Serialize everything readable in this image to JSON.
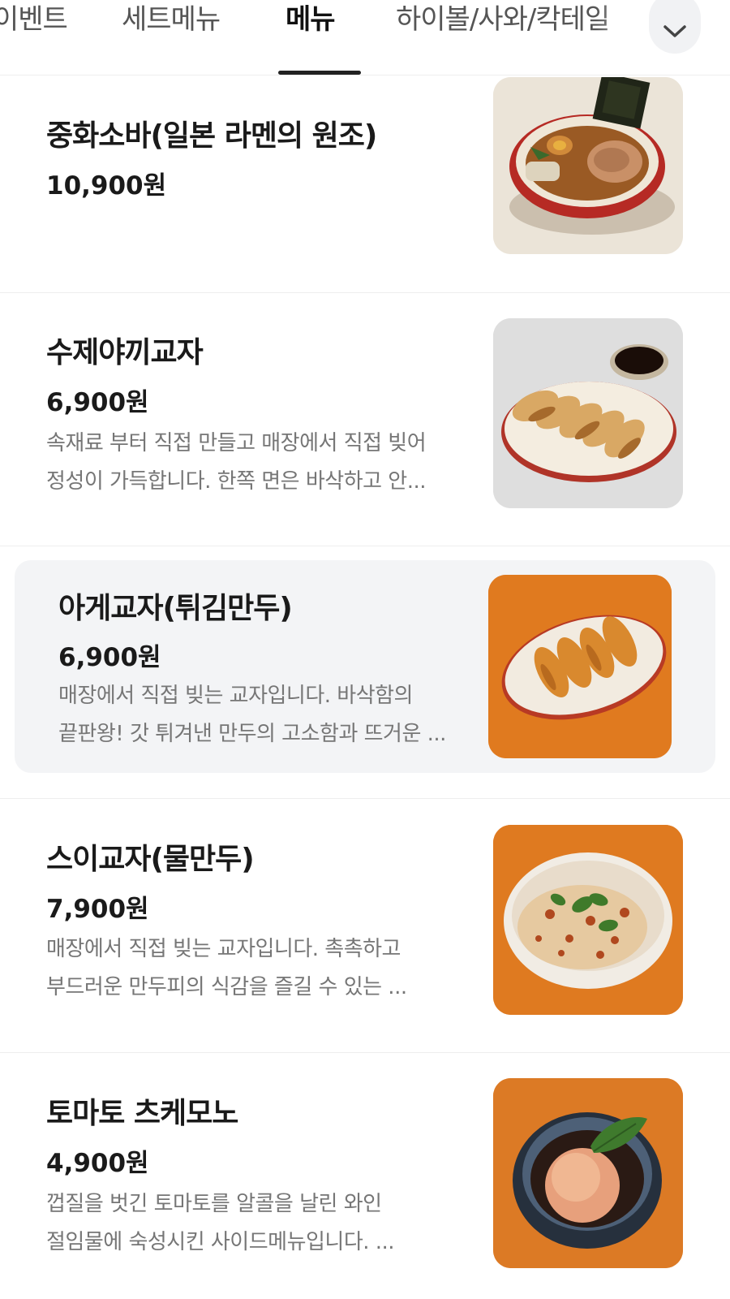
{
  "tabs": [
    {
      "label": "이벤트"
    },
    {
      "label": "세트메뉴"
    },
    {
      "label": "메뉴"
    },
    {
      "label": "하이볼/사와/칵테일"
    }
  ],
  "active_tab": "메뉴",
  "menu_items": [
    {
      "name": "중화소바(일본 라멘의 원조)",
      "price": "10,900원",
      "desc_lines": []
    },
    {
      "name": "수제야끼교자",
      "price": "6,900원",
      "desc_lines": [
        "속재료 부터 직접 만들고 매장에서 직접 빚어",
        "정성이 가득합니다. 한쪽 면은 바삭하고 안..."
      ]
    },
    {
      "name": "아게교자(튀김만두)",
      "price": "6,900원",
      "desc_lines": [
        "매장에서 직접 빚는 교자입니다. 바삭함의",
        "끝판왕! 갓 튀겨낸 만두의 고소함과 뜨거운 ..."
      ]
    },
    {
      "name": "스이교자(물만두)",
      "price": "7,900원",
      "desc_lines": [
        "매장에서 직접 빚는 교자입니다. 촉촉하고",
        "부드러운 만두피의 식감을 즐길 수 있는 ..."
      ]
    },
    {
      "name": "토마토 츠케모노",
      "price": "4,900원",
      "desc_lines": [
        "껍질을 벗긴 토마토를 알콜을 날린 와인",
        "절임물에 숙성시킨 사이드메뉴입니다. ..."
      ]
    }
  ],
  "colors": {
    "highlight_bg": "#f3f4f6",
    "divider": "#eeeeee",
    "orange_bg": "#e07a1f",
    "text_primary": "#1a1a1a",
    "text_secondary": "#767676"
  },
  "icons": {
    "more_tabs": "chevron-down-icon"
  }
}
